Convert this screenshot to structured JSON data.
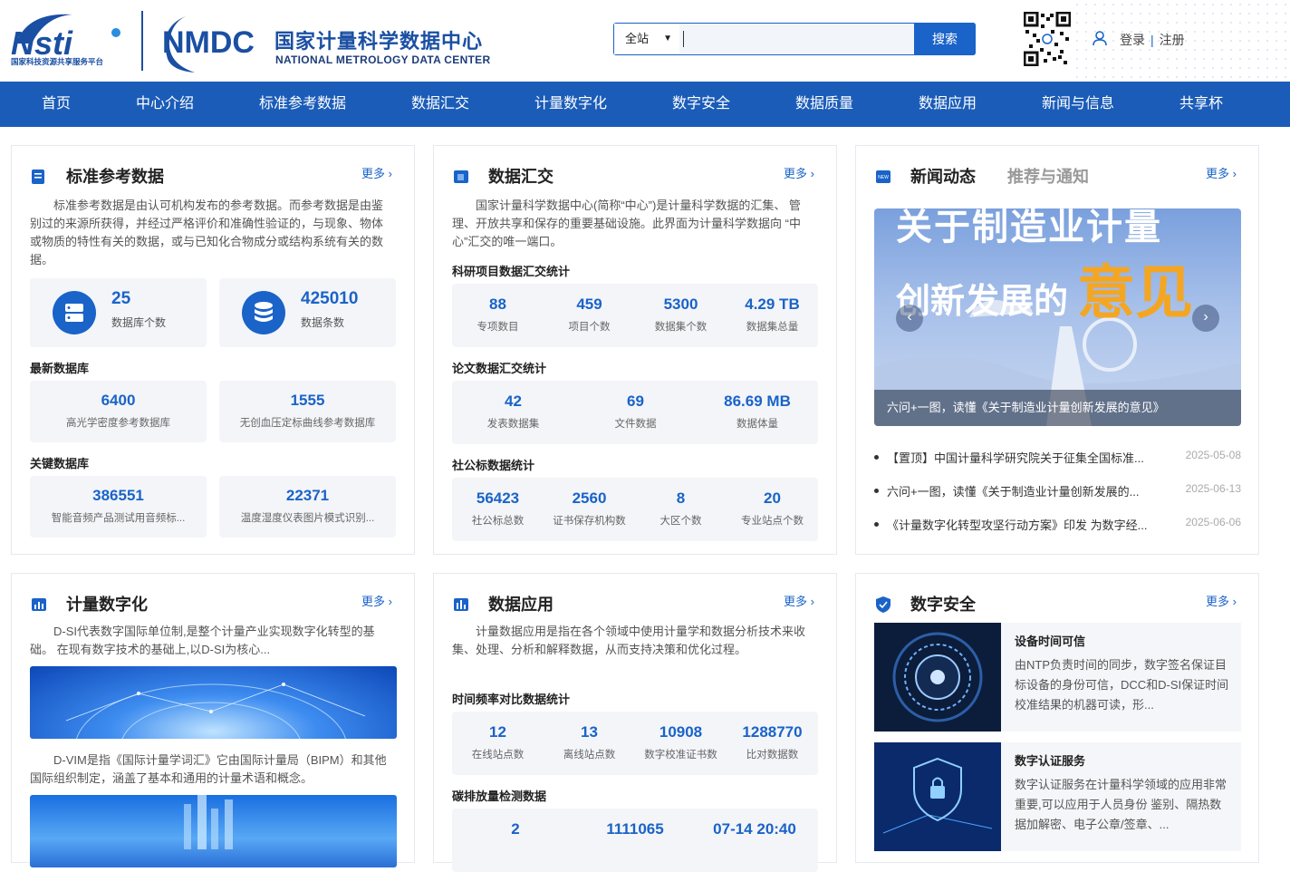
{
  "header": {
    "logo_nsti_text": "Nsti",
    "logo_nsti_sub": "国家科技资源共享服务平台",
    "logo_nmdc_text": "NMDC",
    "site_title_cn": "国家计量科学数据中心",
    "site_title_en": "NATIONAL METROLOGY DATA CENTER",
    "search": {
      "scope": "全站",
      "placeholder": "",
      "button": "搜索"
    },
    "login": "登录",
    "divider": "|",
    "register": "注册"
  },
  "nav": [
    "首页",
    "中心介绍",
    "标准参考数据",
    "数据汇交",
    "计量数字化",
    "数字安全",
    "数据质量",
    "数据应用",
    "新闻与信息",
    "共享杯"
  ],
  "more_label": "更多 ›",
  "std": {
    "title": "标准参考数据",
    "desc": "标准参考数据是由认可机构发布的参考数据。而参考数据是由鉴别过的来源所获得，并经过严格评价和准确性验证的，与现象、物体或物质的特性有关的数据，或与已知化合物成分或结构系统有关的数据。",
    "db_count": "25",
    "db_count_label": "数据库个数",
    "rec_count": "425010",
    "rec_count_label": "数据条数",
    "latest_label": "最新数据库",
    "latest": [
      {
        "num": "6400",
        "label": "高光学密度参考数据库"
      },
      {
        "num": "1555",
        "label": "无创血压定标曲线参考数据库"
      }
    ],
    "key_label": "关键数据库",
    "key": [
      {
        "num": "386551",
        "label": "智能音频产品测试用音频标..."
      },
      {
        "num": "22371",
        "label": "温度湿度仪表图片模式识别..."
      }
    ]
  },
  "collect": {
    "title": "数据汇交",
    "desc": "国家计量科学数据中心(简称“中心”)是计量科学数据的汇集、 管理、开放共享和保存的重要基础设施。此界面为计量科学数据向 “中心”汇交的唯一端口。",
    "s1_label": "科研项目数据汇交统计",
    "s1": [
      {
        "num": "88",
        "label": "专项数目"
      },
      {
        "num": "459",
        "label": "项目个数"
      },
      {
        "num": "5300",
        "label": "数据集个数"
      },
      {
        "num": "4.29 TB",
        "label": "数据集总量"
      }
    ],
    "s2_label": "论文数据汇交统计",
    "s2": [
      {
        "num": "42",
        "label": "发表数据集"
      },
      {
        "num": "69",
        "label": "文件数据"
      },
      {
        "num": "86.69 MB",
        "label": "数据体量"
      }
    ],
    "s3_label": "社公标数据统计",
    "s3": [
      {
        "num": "56423",
        "label": "社公标总数"
      },
      {
        "num": "2560",
        "label": "证书保存机构数"
      },
      {
        "num": "8",
        "label": "大区个数"
      },
      {
        "num": "20",
        "label": "专业站点个数"
      }
    ]
  },
  "news": {
    "title": "新闻动态",
    "title2": "推荐与通知",
    "banner_line1": "关于制造业计量",
    "banner_line2a": "创新发展的",
    "banner_line2b": "意见",
    "banner_caption": "六问+一图，读懂《关于制造业计量创新发展的意见》",
    "items": [
      {
        "text": "【置顶】中国计量科学研究院关于征集全国标准...",
        "date": "2025-05-08"
      },
      {
        "text": "六问+一图，读懂《关于制造业计量创新发展的...",
        "date": "2025-06-13"
      },
      {
        "text": "《计量数字化转型攻坚行动方案》印发 为数字经...",
        "date": "2025-06-06"
      }
    ]
  },
  "digital": {
    "title": "计量数字化",
    "desc1": "D-SI代表数字国际单位制,是整个计量产业实现数字化转型的基础。 在现有数字技术的基础上,以D-SI为核心...",
    "desc2": "D-VIM是指《国际计量学词汇》它由国际计量局（BIPM）和其他国际组织制定，涵盖了基本和通用的计量术语和概念。"
  },
  "app": {
    "title": "数据应用",
    "desc": "计量数据应用是指在各个领域中使用计量学和数据分析技术来收集、处理、分析和解释数据，从而支持决策和优化过程。",
    "s1_label": "时间频率对比数据统计",
    "s1": [
      {
        "num": "12",
        "label": "在线站点数"
      },
      {
        "num": "13",
        "label": "离线站点数"
      },
      {
        "num": "10908",
        "label": "数字校准证书数"
      },
      {
        "num": "1288770",
        "label": "比对数据数"
      }
    ],
    "s2_label": "碳排放量检测数据",
    "s2": [
      {
        "num": "2",
        "label": ""
      },
      {
        "num": "1111065",
        "label": ""
      },
      {
        "num": "07-14 20:40",
        "label": ""
      }
    ]
  },
  "security": {
    "title": "数字安全",
    "items": [
      {
        "title": "设备时间可信",
        "desc": "由NTP负责时间的同步，数字签名保证目标设备的身份可信，DCC和D-SI保证时间校准结果的机器可读，形..."
      },
      {
        "title": "数字认证服务",
        "desc": "数字认证服务在计量科学领域的应用非常重要,可以应用于人员身份 鉴别、隔热数据加解密、电子公章/签章、..."
      }
    ]
  },
  "colors": {
    "primary": "#1a63c8",
    "nav_bg": "#1b5cb8",
    "stat_bg": "#f3f5f8"
  }
}
